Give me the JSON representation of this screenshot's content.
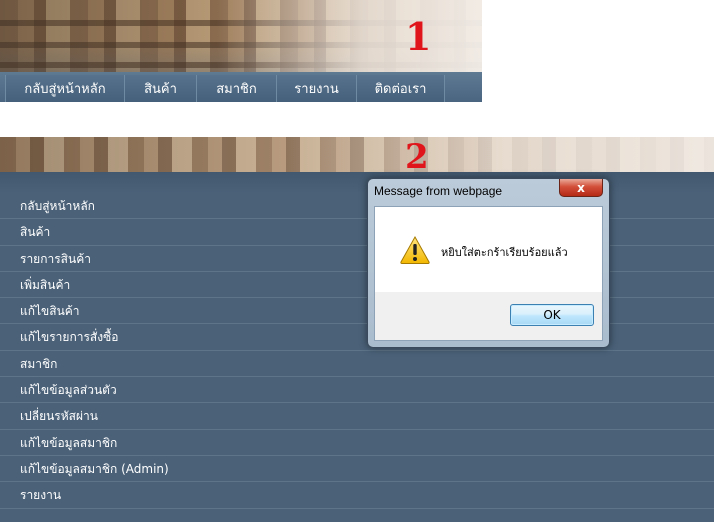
{
  "panel1": {
    "number": "1",
    "nav_items": [
      "กลับสู่หน้าหลัก",
      "สินค้า",
      "สมาชิก",
      "รายงาน",
      "ติดต่อเรา"
    ]
  },
  "panel2": {
    "number": "2",
    "menu_items": [
      "กลับสู่หน้าหลัก",
      "สินค้า",
      "รายการสินค้า",
      "เพิ่มสินค้า",
      "แก้ไขสินค้า",
      "แก้ไขรายการสั่งซื้อ",
      "สมาชิก",
      "แก้ไขข้อมูลส่วนตัว",
      "เปลี่ยนรหัสผ่าน",
      "แก้ไขข้อมูลสมาชิก",
      "แก้ไขข้อมูลสมาชิก (Admin)",
      "รายงาน"
    ]
  },
  "dialog": {
    "title": "Message from webpage",
    "message": "หยิบใส่ตะกร้าเรียบร้อยแล้ว",
    "ok_label": "OK",
    "close_label": "x",
    "icon": "warning-icon"
  },
  "colors": {
    "nav_bg": "#4a6580",
    "menu_bg": "#4a6178",
    "number_red": "#e0151b"
  }
}
